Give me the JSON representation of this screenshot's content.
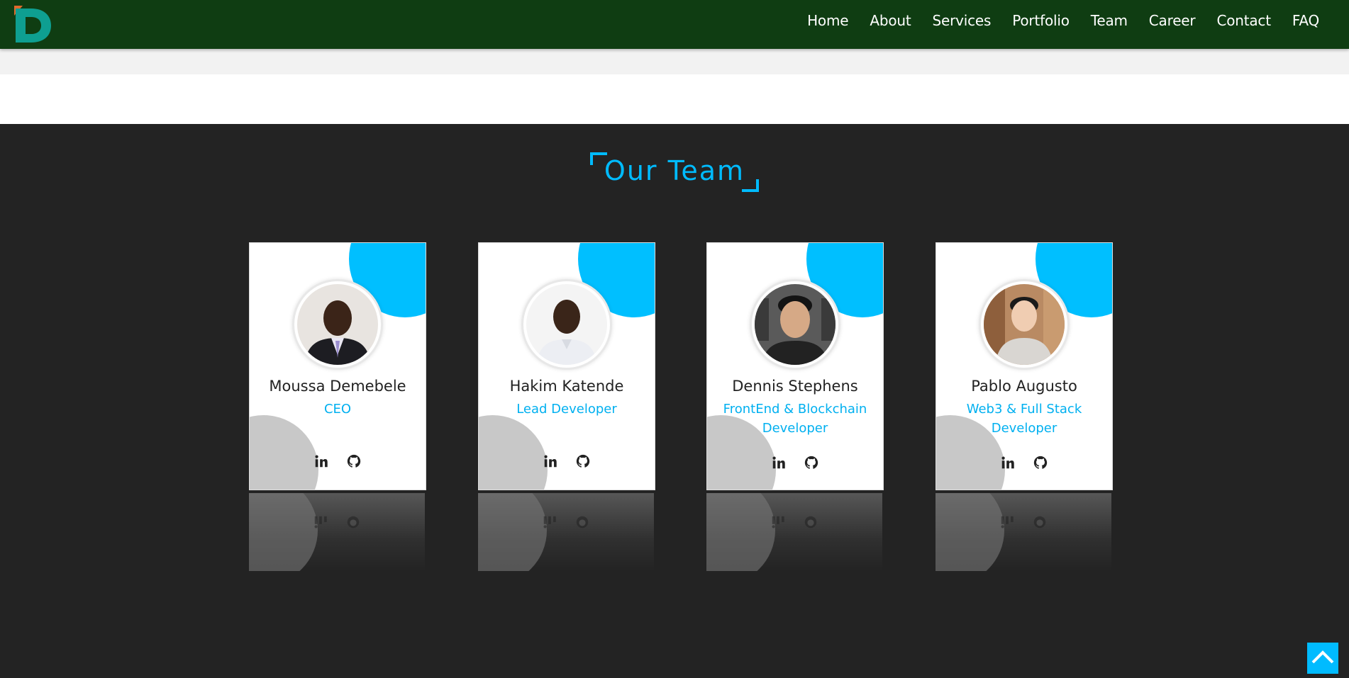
{
  "nav": {
    "logo_icon": "dappros-logo",
    "links": [
      "Home",
      "About",
      "Services",
      "Portfolio",
      "Team",
      "Career",
      "Contact",
      "FAQ"
    ]
  },
  "team": {
    "title": "Our Team",
    "members": [
      {
        "name": "Moussa Demebele",
        "role": "CEO",
        "social_icons": [
          "linkedin-icon",
          "github-icon"
        ]
      },
      {
        "name": "Hakim Katende",
        "role": "Lead Developer",
        "social_icons": [
          "linkedin-icon",
          "github-icon"
        ]
      },
      {
        "name": "Dennis Stephens",
        "role": "FrontEnd & Blockchain Developer",
        "social_icons": [
          "linkedin-icon",
          "github-icon"
        ]
      },
      {
        "name": "Pablo Augusto",
        "role": "Web3 & Full Stack Developer",
        "social_icons": [
          "linkedin-icon",
          "github-icon"
        ]
      }
    ]
  },
  "back_to_top": {
    "icon": "chevron-up-icon"
  },
  "colors": {
    "navbar": "#0f3d12",
    "accent": "#00bbff",
    "section_bg": "#232323",
    "card_blob_grey": "#c8c8c8"
  }
}
